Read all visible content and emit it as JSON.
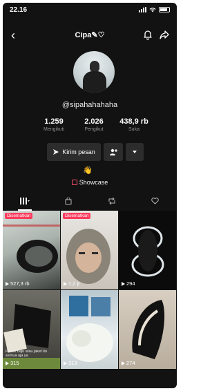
{
  "status_bar": {
    "time": "22.16"
  },
  "header": {
    "title": "Cipa✎♡"
  },
  "profile": {
    "handle": "@sipahahahaha",
    "stats": [
      {
        "value": "1.259",
        "label": "Mengikuti"
      },
      {
        "value": "2.026",
        "label": "Pengikut"
      },
      {
        "value": "438,9 rb",
        "label": "Suka"
      }
    ],
    "message_button": "Kirim pesan",
    "showcase_label": "Showcase"
  },
  "videos": [
    {
      "pinned": "Disematkan",
      "views": "527,3 rb",
      "caption": ""
    },
    {
      "pinned": "Disematkan",
      "views": "1,2 jt",
      "caption": ""
    },
    {
      "pinned": "",
      "views": "294",
      "caption": ""
    },
    {
      "pinned": "",
      "views": "315",
      "caption": "Pakek baju atau jaket itu semua aja ya"
    },
    {
      "pinned": "",
      "views": "313",
      "caption": ""
    },
    {
      "pinned": "",
      "views": "274",
      "caption": ""
    }
  ],
  "colors": {
    "background": "#121212",
    "accent": "#ff3b5c"
  }
}
